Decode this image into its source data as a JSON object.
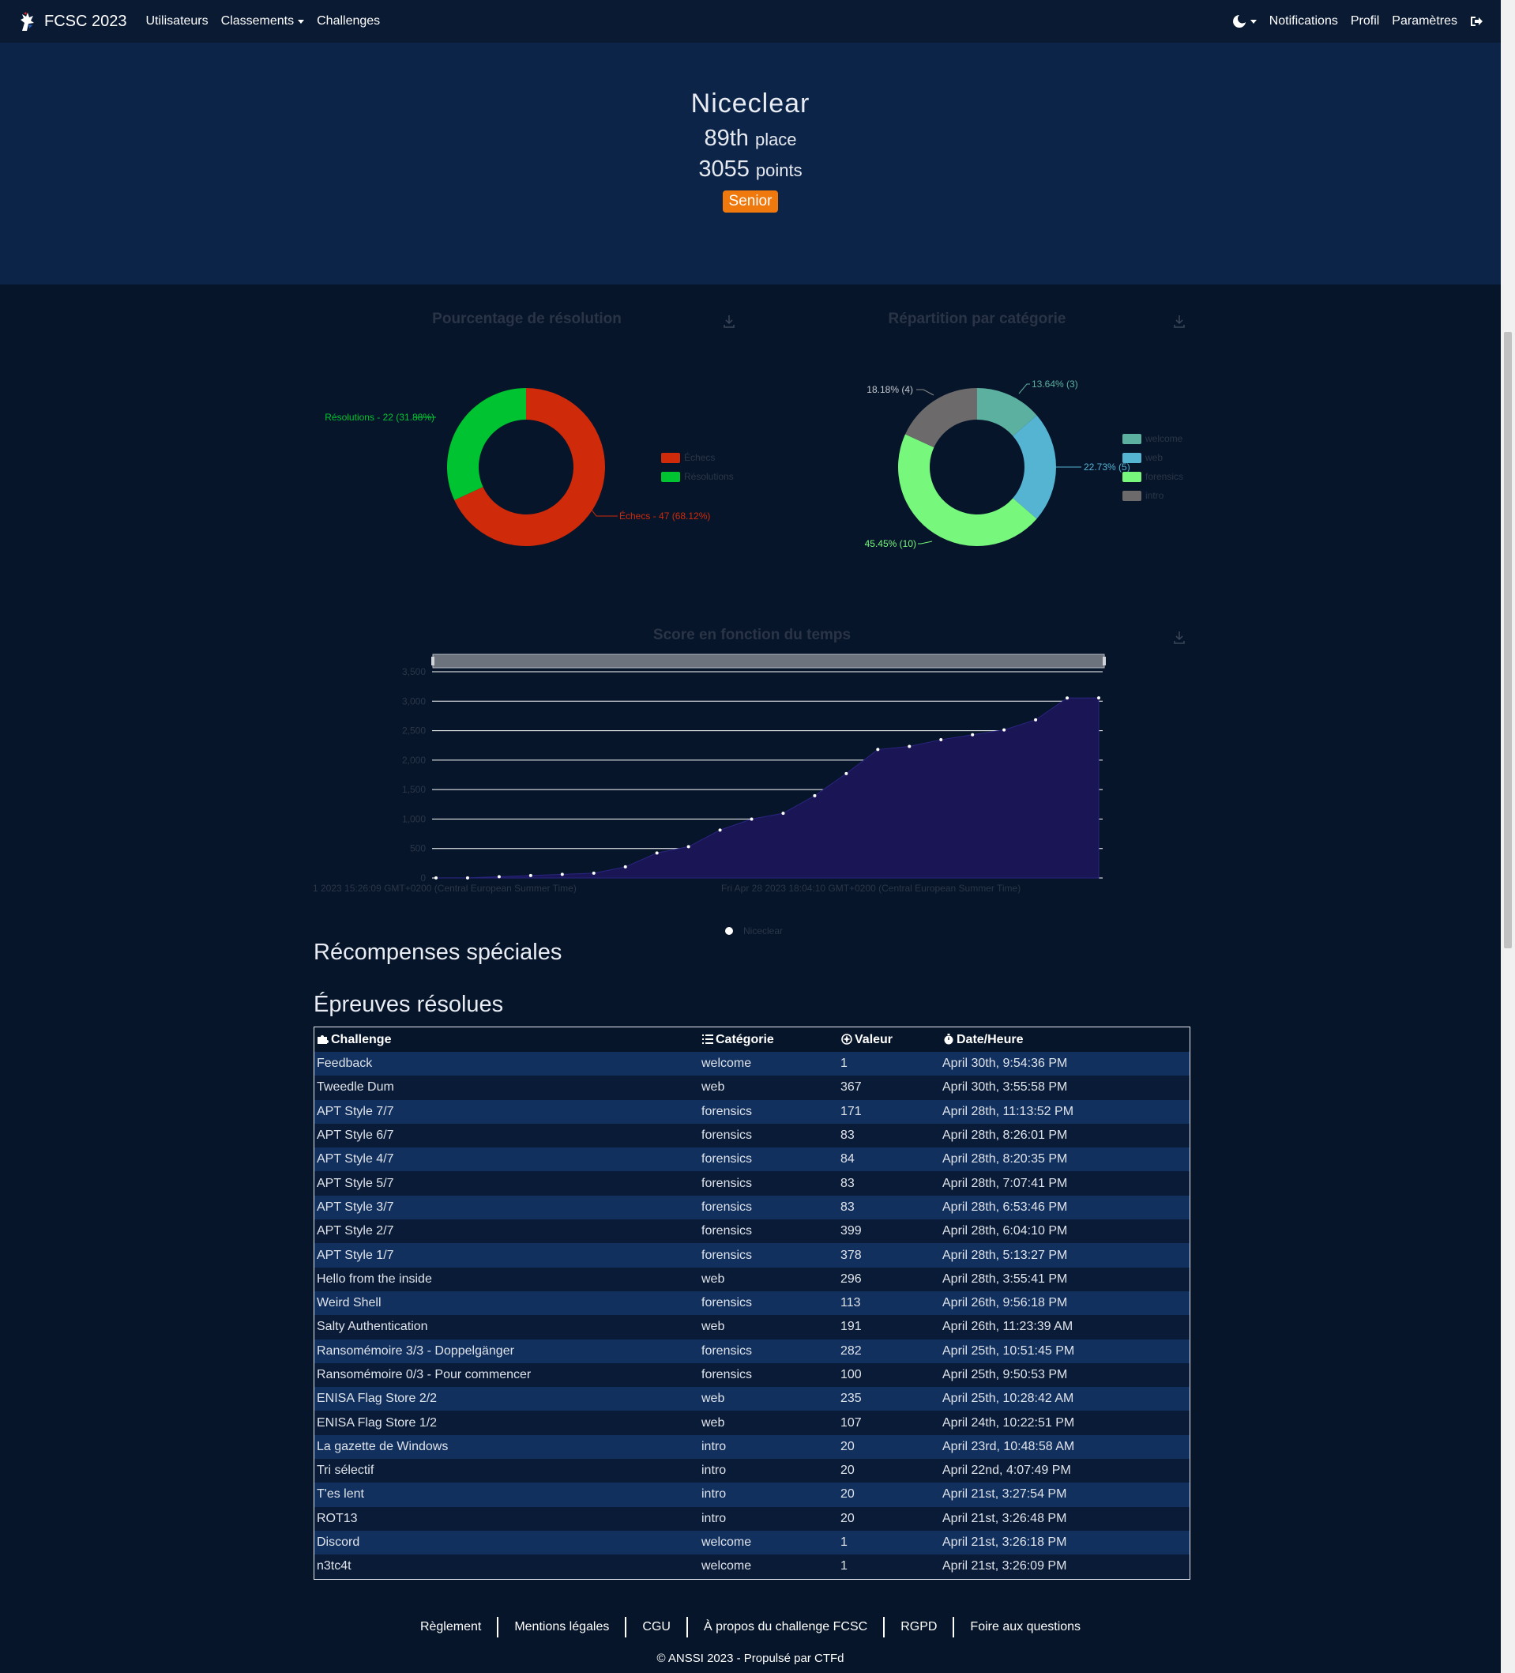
{
  "nav": {
    "brand": "FCSC 2023",
    "left_items": [
      "Utilisateurs",
      "Classements",
      "Challenges"
    ],
    "right_items": [
      "Notifications",
      "Profil",
      "Paramètres"
    ]
  },
  "profile": {
    "name": "Niceclear",
    "place_number": "89th",
    "place_label": "place",
    "points_number": "3055",
    "points_label": "points",
    "badge": "Senior",
    "badge_color": "#f0790e"
  },
  "charts": {
    "resolution_title": "Pourcentage de résolution",
    "category_title": "Répartition par catégorie",
    "score_title": "Score en fonction du temps"
  },
  "chart_data": [
    {
      "type": "pie",
      "title": "Pourcentage de résolution",
      "legend": "right",
      "labels": [
        "Échecs",
        "Résolutions"
      ],
      "values": [
        47,
        22
      ],
      "percentages": [
        68.12,
        31.88
      ],
      "colors": [
        "#cf2a0a",
        "#00c331"
      ],
      "annotations": [
        "Échecs - 47 (68.12%)",
        "Résolutions - 22 (31.88%)"
      ]
    },
    {
      "type": "pie",
      "title": "Répartition par catégorie",
      "legend": "right",
      "labels": [
        "welcome",
        "web",
        "forensics",
        "intro"
      ],
      "values": [
        3,
        5,
        10,
        4
      ],
      "percentages": [
        13.64,
        22.73,
        45.45,
        18.18
      ],
      "colors": [
        "#5cb0a0",
        "#56b4d3",
        "#77f77b",
        "#6c6a6a"
      ],
      "annotations": [
        "13.64% (3)",
        "22.73% (5)",
        "45.45% (10)",
        "18.18% (4)"
      ]
    },
    {
      "type": "area",
      "title": "Score en fonction du temps",
      "legend": "bottom",
      "series": [
        {
          "name": "Niceclear",
          "values": [
            1,
            2,
            22,
            42,
            62,
            82,
            189,
            424,
            531,
            813,
            999,
            1098,
            1397,
            1772,
            2180,
            2233,
            2346,
            2430,
            2513,
            2684,
            3054,
            3055
          ]
        }
      ],
      "x_tick_labels": [
        "1 2023 15:26:09 GMT+0200 (Central European Summer Time)",
        "Fri Apr 28 2023 18:04:10 GMT+0200 (Central European Summer Time)"
      ],
      "y_ticks": [
        0,
        500,
        1000,
        1500,
        2000,
        2500,
        3000,
        3500
      ],
      "y_tick_labels": [
        "0",
        "500",
        "1,000",
        "1,500",
        "2,000",
        "2,500",
        "3,000",
        "3,500"
      ],
      "ylim": [
        0,
        3500
      ],
      "grid": true,
      "colors": [
        "#1a1554"
      ]
    }
  ],
  "sections": {
    "awards_title": "Récompenses spéciales",
    "solves_title": "Épreuves résolues"
  },
  "table": {
    "headers": [
      "Challenge",
      "Catégorie",
      "Valeur",
      "Date/Heure"
    ],
    "rows": [
      [
        "Feedback",
        "welcome",
        "1",
        "April 30th, 9:54:36 PM"
      ],
      [
        "Tweedle Dum",
        "web",
        "367",
        "April 30th, 3:55:58 PM"
      ],
      [
        "APT Style 7/7",
        "forensics",
        "171",
        "April 28th, 11:13:52 PM"
      ],
      [
        "APT Style 6/7",
        "forensics",
        "83",
        "April 28th, 8:26:01 PM"
      ],
      [
        "APT Style 4/7",
        "forensics",
        "84",
        "April 28th, 8:20:35 PM"
      ],
      [
        "APT Style 5/7",
        "forensics",
        "83",
        "April 28th, 7:07:41 PM"
      ],
      [
        "APT Style 3/7",
        "forensics",
        "83",
        "April 28th, 6:53:46 PM"
      ],
      [
        "APT Style 2/7",
        "forensics",
        "399",
        "April 28th, 6:04:10 PM"
      ],
      [
        "APT Style 1/7",
        "forensics",
        "378",
        "April 28th, 5:13:27 PM"
      ],
      [
        "Hello from the inside",
        "web",
        "296",
        "April 28th, 3:55:41 PM"
      ],
      [
        "Weird Shell",
        "forensics",
        "113",
        "April 26th, 9:56:18 PM"
      ],
      [
        "Salty Authentication",
        "web",
        "191",
        "April 26th, 11:23:39 AM"
      ],
      [
        "Ransomémoire 3/3 - Doppelgänger",
        "forensics",
        "282",
        "April 25th, 10:51:45 PM"
      ],
      [
        "Ransomémoire 0/3 - Pour commencer",
        "forensics",
        "100",
        "April 25th, 9:50:53 PM"
      ],
      [
        "ENISA Flag Store 2/2",
        "web",
        "235",
        "April 25th, 10:28:42 AM"
      ],
      [
        "ENISA Flag Store 1/2",
        "web",
        "107",
        "April 24th, 10:22:51 PM"
      ],
      [
        "La gazette de Windows",
        "intro",
        "20",
        "April 23rd, 10:48:58 AM"
      ],
      [
        "Tri sélectif",
        "intro",
        "20",
        "April 22nd, 4:07:49 PM"
      ],
      [
        "T'es lent",
        "intro",
        "20",
        "April 21st, 3:27:54 PM"
      ],
      [
        "ROT13",
        "intro",
        "20",
        "April 21st, 3:26:48 PM"
      ],
      [
        "Discord",
        "welcome",
        "1",
        "April 21st, 3:26:18 PM"
      ],
      [
        "n3tc4t",
        "welcome",
        "1",
        "April 21st, 3:26:09 PM"
      ]
    ]
  },
  "footer": {
    "links": [
      "Règlement",
      "Mentions légales",
      "CGU",
      "À propos du challenge FCSC",
      "RGPD",
      "Foire aux questions"
    ],
    "copyright": "© ANSSI 2023 - Propulsé par CTFd"
  },
  "icons": [
    "rooster-logo-icon",
    "theme-moon-icon",
    "logout-icon",
    "download-icon",
    "puzzle-icon",
    "list-icon",
    "value-icon",
    "stopwatch-icon"
  ]
}
